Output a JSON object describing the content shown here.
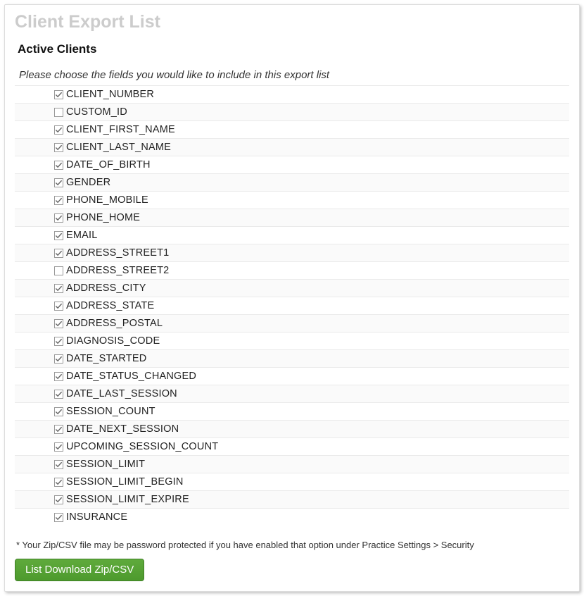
{
  "page_title": "Client Export List",
  "section_title": "Active Clients",
  "instruction": "Please choose the fields you would like to include in this export list",
  "fields": [
    {
      "label": "CLIENT_NUMBER",
      "checked": true
    },
    {
      "label": "CUSTOM_ID",
      "checked": false
    },
    {
      "label": "CLIENT_FIRST_NAME",
      "checked": true
    },
    {
      "label": "CLIENT_LAST_NAME",
      "checked": true
    },
    {
      "label": "DATE_OF_BIRTH",
      "checked": true
    },
    {
      "label": "GENDER",
      "checked": true
    },
    {
      "label": "PHONE_MOBILE",
      "checked": true
    },
    {
      "label": "PHONE_HOME",
      "checked": true
    },
    {
      "label": "EMAIL",
      "checked": true
    },
    {
      "label": "ADDRESS_STREET1",
      "checked": true
    },
    {
      "label": "ADDRESS_STREET2",
      "checked": false
    },
    {
      "label": "ADDRESS_CITY",
      "checked": true
    },
    {
      "label": "ADDRESS_STATE",
      "checked": true
    },
    {
      "label": "ADDRESS_POSTAL",
      "checked": true
    },
    {
      "label": "DIAGNOSIS_CODE",
      "checked": true
    },
    {
      "label": "DATE_STARTED",
      "checked": true
    },
    {
      "label": "DATE_STATUS_CHANGED",
      "checked": true
    },
    {
      "label": "DATE_LAST_SESSION",
      "checked": true
    },
    {
      "label": "SESSION_COUNT",
      "checked": true
    },
    {
      "label": "DATE_NEXT_SESSION",
      "checked": true
    },
    {
      "label": "UPCOMING_SESSION_COUNT",
      "checked": true
    },
    {
      "label": "SESSION_LIMIT",
      "checked": true
    },
    {
      "label": "SESSION_LIMIT_BEGIN",
      "checked": true
    },
    {
      "label": "SESSION_LIMIT_EXPIRE",
      "checked": true
    },
    {
      "label": "INSURANCE",
      "checked": true
    }
  ],
  "footnote": "* Your Zip/CSV file may be password protected if you have enabled that option under Practice Settings > Security",
  "download_button_label": "List Download Zip/CSV"
}
